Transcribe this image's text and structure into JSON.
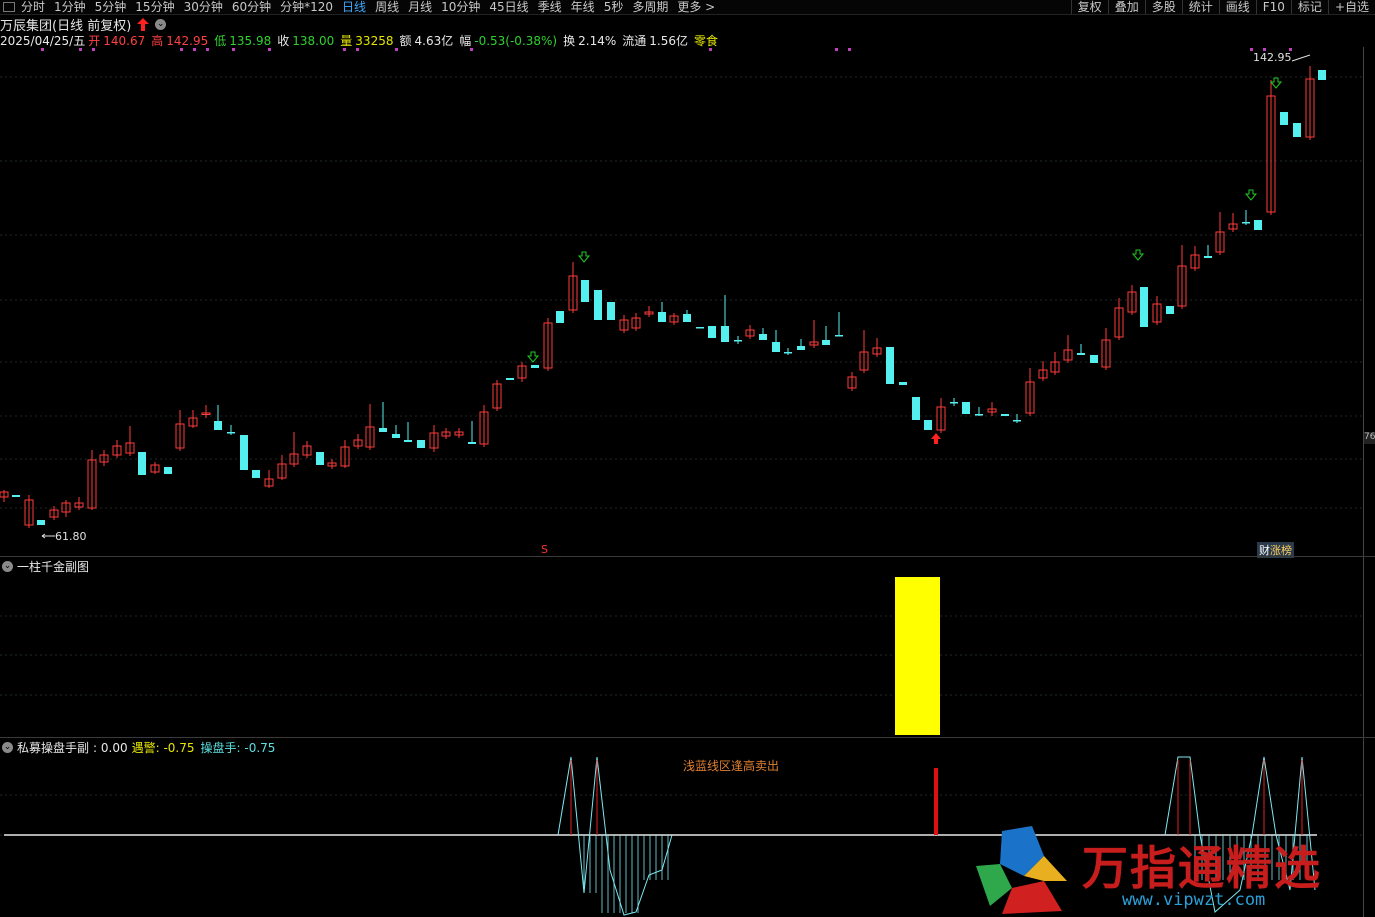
{
  "toolbar": {
    "periods": [
      "分时",
      "1分钟",
      "5分钟",
      "15分钟",
      "30分钟",
      "60分钟",
      "分钟*120",
      "日线",
      "周线",
      "月线",
      "10分钟",
      "45日线",
      "季线",
      "年线",
      "5秒",
      "多周期",
      "更多 >"
    ],
    "active_index": 7,
    "right_tools": [
      "复权",
      "叠加",
      "多股",
      "统计",
      "画线",
      "F10",
      "标记",
      "+自选"
    ]
  },
  "stock": {
    "name": "万辰集团(日线 前复权)",
    "date": "2025/04/25/五",
    "open_label": "开",
    "open": "140.67",
    "high_label": "高",
    "high": "142.95",
    "low_label": "低",
    "low": "135.98",
    "close_label": "收",
    "close": "138.00",
    "vol_label": "量",
    "vol": "33258",
    "amount_label": "额",
    "amount": "4.63亿",
    "change_label": "幅",
    "change": "-0.53(-0.38%)",
    "turnover_label": "换",
    "turnover": "2.14%",
    "float_label": "流通",
    "float": "1.56亿",
    "sector": "零食"
  },
  "main_chart": {
    "high_marker": "142.95",
    "low_marker": "61.80",
    "s_marker": "S",
    "badge_a": "财",
    "badge_b": "涨榜",
    "right_axis_tag": "76",
    "colors": {
      "up": "#ff3c3c",
      "down": "#54f0f0",
      "signal": "#22cc22",
      "purple": "#c040c0"
    }
  },
  "panel1": {
    "title": "一柱千金副图",
    "bar_color": "#ffff00"
  },
  "panel2": {
    "title": "私募操盘手副",
    "v0": ": 0.00",
    "alert_label": "遇警",
    "alert_value": ": -0.75",
    "trader_label": "操盘手",
    "trader_value": ": -0.75",
    "note": "浅蓝线区逢高卖出"
  },
  "watermark": {
    "text": "万指通精选",
    "url": "www.vipwzt.com"
  }
}
